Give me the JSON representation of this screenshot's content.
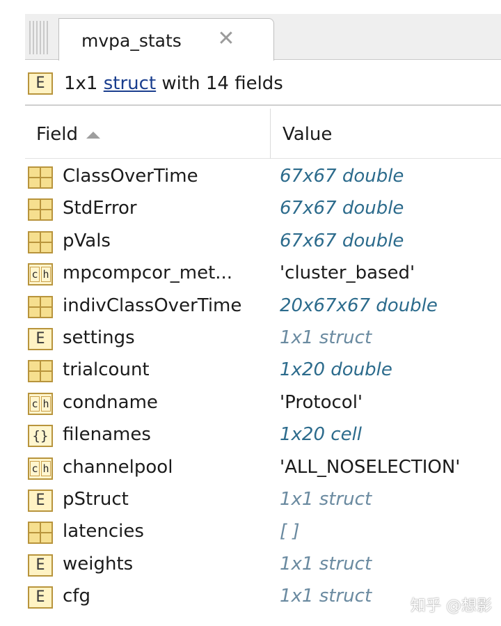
{
  "tab": {
    "title": "mvpa_stats",
    "close_glyph": "✕"
  },
  "description": {
    "prefix": "1x1 ",
    "link": "struct",
    "suffix": " with 14 fields"
  },
  "columns": {
    "field": "Field",
    "value": "Value"
  },
  "rows": [
    {
      "name": "ClassOverTime",
      "value": "67x67 double",
      "icon": "matrix-icon",
      "style": "meta"
    },
    {
      "name": "StdError",
      "value": "67x67 double",
      "icon": "matrix-icon",
      "style": "meta"
    },
    {
      "name": "pVals",
      "value": "67x67 double",
      "icon": "matrix-icon",
      "style": "meta"
    },
    {
      "name": "mpcompcor_met...",
      "value": "'cluster_based'",
      "icon": "char-icon",
      "style": "plain"
    },
    {
      "name": "indivClassOverTime",
      "value": "20x67x67 double",
      "icon": "matrix-icon",
      "style": "meta"
    },
    {
      "name": "settings",
      "value": "1x1 struct",
      "icon": "struct-icon",
      "style": "struct"
    },
    {
      "name": "trialcount",
      "value": "1x20 double",
      "icon": "matrix-icon",
      "style": "meta"
    },
    {
      "name": "condname",
      "value": "'Protocol'",
      "icon": "char-icon",
      "style": "plain"
    },
    {
      "name": "filenames",
      "value": "1x20 cell",
      "icon": "cell-icon",
      "style": "meta"
    },
    {
      "name": "channelpool",
      "value": "'ALL_NOSELECTION'",
      "icon": "char-icon",
      "style": "plain"
    },
    {
      "name": "pStruct",
      "value": "1x1 struct",
      "icon": "struct-icon",
      "style": "struct"
    },
    {
      "name": "latencies",
      "value": "[ ]",
      "icon": "matrix-icon",
      "style": "struct"
    },
    {
      "name": "weights",
      "value": "1x1 struct",
      "icon": "struct-icon",
      "style": "struct"
    },
    {
      "name": "cfg",
      "value": "1x1 struct",
      "icon": "struct-icon",
      "style": "struct"
    }
  ],
  "watermark": "知乎 @想影"
}
